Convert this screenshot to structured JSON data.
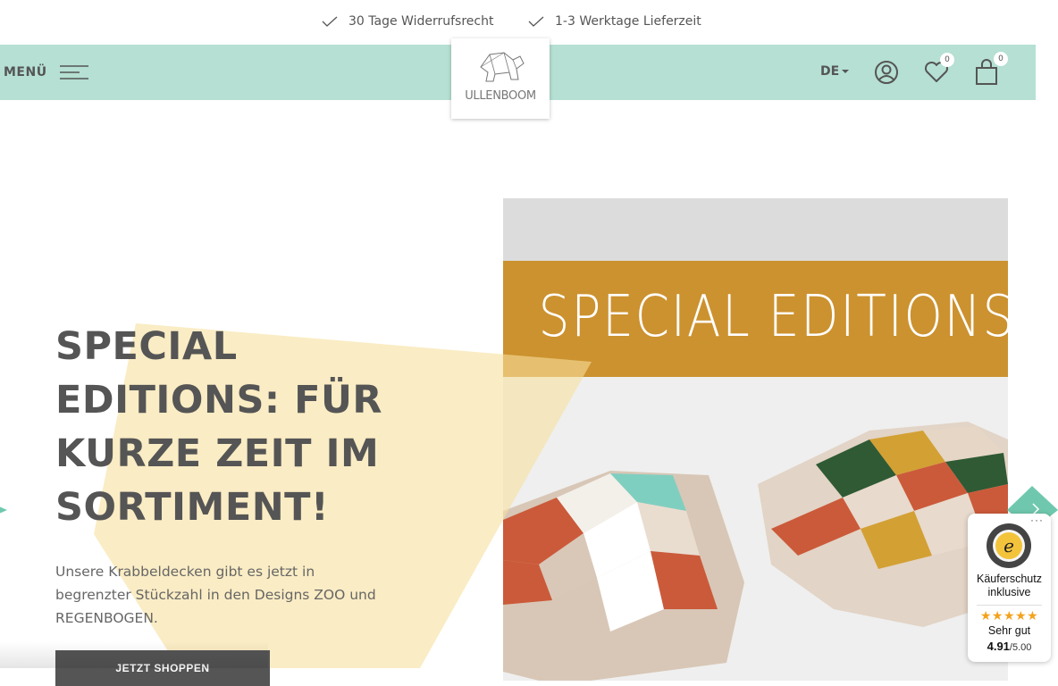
{
  "topbar": {
    "usp1": "30 Tage Widerrufsrecht",
    "usp2": "1-3 Werktage Lieferzeit"
  },
  "nav": {
    "menu_label": "MENÜ",
    "logo_text": "ULLENBOOM",
    "language": "DE",
    "wishlist_count": "0",
    "cart_count": "0"
  },
  "hero": {
    "headline_line1": "SPECIAL",
    "headline_line2": "EDITIONS: FÜR",
    "headline_line3": "KURZE ZEIT IM",
    "headline_line4": "SORTIMENT!",
    "description": "Unsere Krabbeldecken gibt es jetzt in begrenzter Stückzahl in den Designs ZOO und REGENBOGEN.",
    "cta_label": "JETZT SHOPPEN",
    "image_banner_text": "SPECIAL EDITIONS"
  },
  "trust_badge": {
    "line1": "Käuferschutz",
    "line2": "inklusive",
    "stars": "★★★★★",
    "rating_text": "Sehr gut",
    "score": "4.91",
    "score_max": "/5.00"
  },
  "colors": {
    "nav_bg": "#b5e0d3",
    "accent_yellow": "#f7df9c",
    "banner_orange": "#cc922f",
    "text_dark": "#555555",
    "star": "#f4a21b"
  }
}
